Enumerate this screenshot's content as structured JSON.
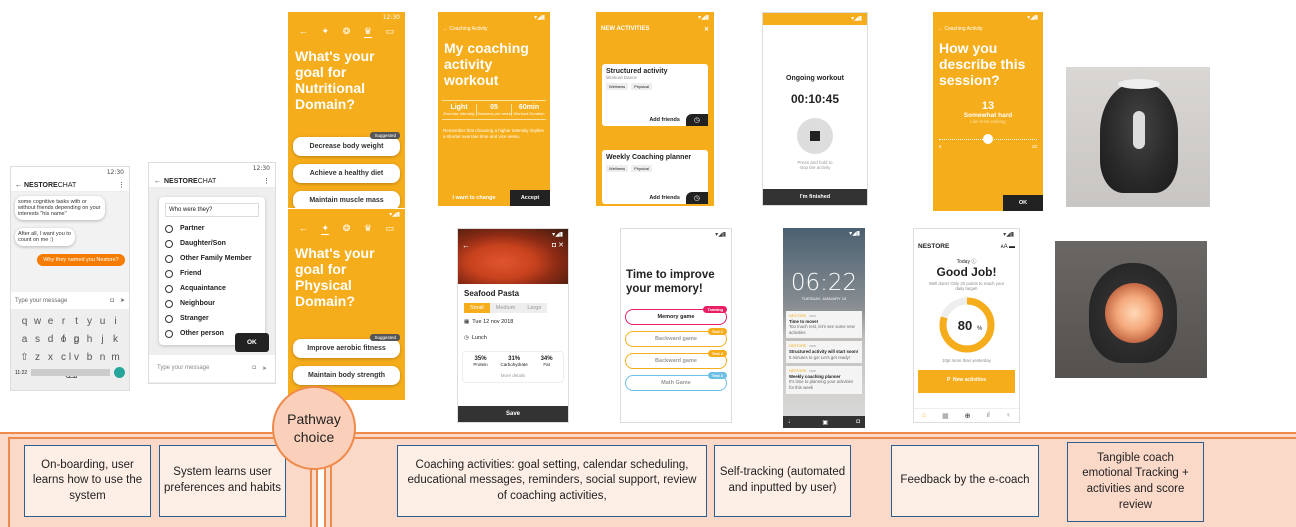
{
  "p1": {
    "status": "12:30",
    "app": "NESTORE",
    "app2": "CHAT",
    "msg1": "some cognitive tasks with or without friends depending on your interests \"his name\"",
    "msg2": "After all, I want you to count on me :)",
    "reply": "Why they named you Nestore?",
    "input_ph": "Type your message",
    "kb_row1": [
      "q",
      "w",
      "e",
      "r",
      "t",
      "y",
      "u",
      "i",
      "o",
      "p"
    ],
    "kb_row2": [
      "a",
      "s",
      "d",
      "f",
      "g",
      "h",
      "j",
      "k",
      "l"
    ],
    "kb_row3": [
      "z",
      "x",
      "c",
      "v",
      "b",
      "n",
      "m"
    ],
    "kb_bottom": "11:22"
  },
  "p2": {
    "status": "12:30",
    "app": "NESTORE",
    "app2": "CHAT",
    "question": "Who were they?",
    "options": [
      "Partner",
      "Daughter/Son",
      "Other Family Member",
      "Friend",
      "Acquaintance",
      "Neighbour",
      "Stranger",
      "Other person"
    ],
    "ok": "OK",
    "input_ph": "Type your message"
  },
  "p3": {
    "status": "12:30",
    "title": "What's your goal for Nutritional Domain?",
    "tag": "Suggested",
    "options": [
      "Decrease body weight",
      "Achieve a healthy diet",
      "Maintain muscle mass"
    ]
  },
  "p4": {
    "title": "What's your goal for Physical Domain?",
    "tag": "Suggested",
    "options": [
      "Improve aerobic fitness",
      "Maintain body strength"
    ]
  },
  "p5": {
    "header": "Coaching Activity",
    "title": "My coaching activity workout",
    "stats": [
      {
        "v": "Light",
        "l": "Exercise intensity"
      },
      {
        "v": "05",
        "l": "Sessions per week"
      },
      {
        "v": "60min",
        "l": "Workout Duration"
      }
    ],
    "note": "Remember that choosing a higher intensity implies a shorter exercise time and vice versa.",
    "change": "I want to change",
    "accept": "Accept"
  },
  "p6": {
    "header": "NEW ACTIVITIES",
    "a1": "Structured activity",
    "a1sub": "Workout Dance",
    "a2": "Weekly Coaching planner",
    "tags": [
      "Wellness",
      "Physical"
    ],
    "add": "Add friends"
  },
  "p7": {
    "title": "Seafood Pasta",
    "sizes": [
      "Small",
      "Medium",
      "Large"
    ],
    "date": "Tue 12 nov 2018",
    "meal": "Lunch",
    "macros": [
      {
        "v": "35%",
        "l": "Protein"
      },
      {
        "v": "31%",
        "l": "Carbohydrate"
      },
      {
        "v": "34%",
        "l": "Fat"
      }
    ],
    "more": "More details",
    "save": "Save"
  },
  "p8": {
    "title": "Ongoing workout",
    "time": "00:10:45",
    "hint": "Press and hold to stop the activity",
    "finish": "I'm finished"
  },
  "p9": {
    "title": "Time to improve your memory!",
    "games": [
      "Memory game",
      "Backward game",
      "Backward game",
      "Math Game"
    ],
    "tags": [
      "Training",
      "Test 1",
      "Test 2",
      "Test 3"
    ]
  },
  "p10": {
    "clock": "06:22",
    "date": "TUESDAY, JANUARY 15",
    "notifs": [
      {
        "t": "Time to move!",
        "s": "Too much rest, let's see some new activities"
      },
      {
        "t": "Structured activity will start soon!",
        "s": "5 minutes to go! Let's get ready!"
      },
      {
        "t": "Weekly coaching planner",
        "s": "It's time to planning your activities for this week"
      }
    ],
    "app": "NESTORE",
    "ago": "now"
  },
  "p11": {
    "header": "Coaching Activity",
    "title": "How you describe this session?",
    "value": "13",
    "label": "Somewhat hard",
    "sub": "Like brisk walking",
    "min": "6",
    "max": "20",
    "ok": "OK"
  },
  "p12": {
    "logo": "NESTORE",
    "today": "Today",
    "title": "Good Job!",
    "sub": "Well done! Only 20 points to reach your daily target!",
    "percent": "80",
    "unit": "%",
    "compare": "10pt more than yesterday",
    "btn": "New activities",
    "goal_fraction": 0.8
  },
  "pathway": "Pathway choice",
  "boxes": [
    "On-boarding, user learns how to use the system",
    "System learns user preferences and habits",
    "Coaching activities: goal setting, calendar scheduling, educational messages, reminders, social support, review of coaching activities,",
    "Self-tracking (automated and inputted by user)",
    "Feedback by the e-coach",
    "Tangible coach emotional Tracking + activities and score review"
  ],
  "colors": {
    "orange": "#f6ad1b",
    "band": "#fbd9c9",
    "border": "#f08a4b",
    "box_border": "#2e5e8e"
  }
}
